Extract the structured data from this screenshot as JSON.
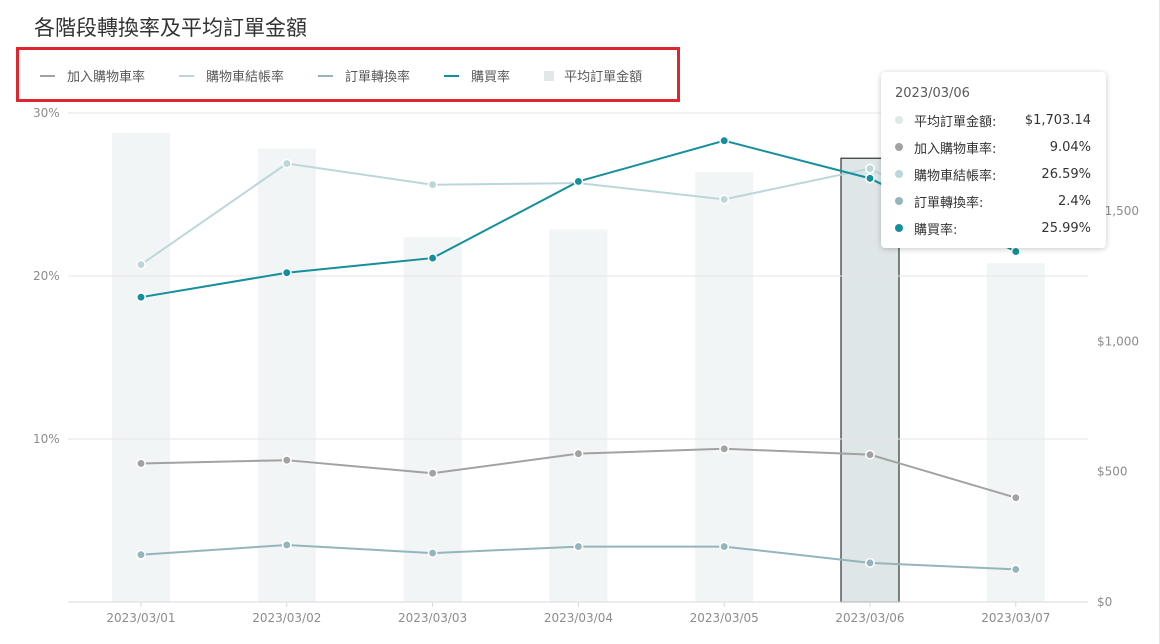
{
  "title": "各階段轉換率及平均訂單金額",
  "chart_data": {
    "type": "bar+line",
    "categories": [
      "2023/03/01",
      "2023/03/02",
      "2023/03/03",
      "2023/03/04",
      "2023/03/05",
      "2023/03/06",
      "2023/03/07"
    ],
    "y_left": {
      "ticks": [
        "30%",
        "20%",
        "10%"
      ],
      "tick_values": [
        30,
        20,
        10
      ],
      "range": [
        0,
        30
      ]
    },
    "y_right": {
      "ticks": [
        "$0",
        "$500",
        "$1,000",
        "$1,500"
      ],
      "tick_values": [
        0,
        500,
        1000,
        1500
      ],
      "range": [
        0,
        1800
      ]
    },
    "grid": true,
    "legend_position": "top-left",
    "bar_series": {
      "name": "平均訂單金額",
      "axis": "right",
      "color": "#f1f5f6",
      "values": [
        1800,
        1740,
        1400,
        1430,
        1650,
        1703.14,
        1300
      ]
    },
    "line_series": [
      {
        "name": "加入購物車率",
        "color": "#a2a2a2",
        "values": [
          8.5,
          8.7,
          7.9,
          9.1,
          9.4,
          9.04,
          6.4
        ]
      },
      {
        "name": "購物車結帳率",
        "color": "#bcd6d9",
        "values": [
          20.7,
          26.9,
          25.6,
          25.7,
          24.7,
          26.59,
          22.0
        ]
      },
      {
        "name": "訂單轉換率",
        "color": "#94b5bb",
        "values": [
          2.9,
          3.5,
          3.0,
          3.4,
          3.4,
          2.4,
          2.0
        ]
      },
      {
        "name": "購買率",
        "color": "#148f9b",
        "values": [
          18.7,
          20.2,
          21.1,
          25.8,
          28.3,
          25.99,
          21.5
        ]
      }
    ],
    "highlight_index": 5
  },
  "legend": [
    {
      "label": "加入購物車率",
      "type": "line",
      "color": "#a2a2a2"
    },
    {
      "label": "購物車結帳率",
      "type": "line",
      "color": "#bcd6d9"
    },
    {
      "label": "訂單轉換率",
      "type": "line",
      "color": "#94b5bb"
    },
    {
      "label": "購買率",
      "type": "line",
      "color": "#148f9b"
    },
    {
      "label": "平均訂單金額",
      "type": "box",
      "color": "#e3e7e8"
    }
  ],
  "tooltip": {
    "date": "2023/03/06",
    "rows": [
      {
        "name": "平均訂單金額:",
        "value": "$1,703.14",
        "color": "#dfe8e9"
      },
      {
        "name": "加入購物車率:",
        "value": "9.04%",
        "color": "#a2a2a2"
      },
      {
        "name": "購物車結帳率:",
        "value": "26.59%",
        "color": "#bcd6d9"
      },
      {
        "name": "訂單轉換率:",
        "value": "2.4%",
        "color": "#94b5bb"
      },
      {
        "name": "購買率:",
        "value": "25.99%",
        "color": "#148f9b"
      }
    ]
  }
}
